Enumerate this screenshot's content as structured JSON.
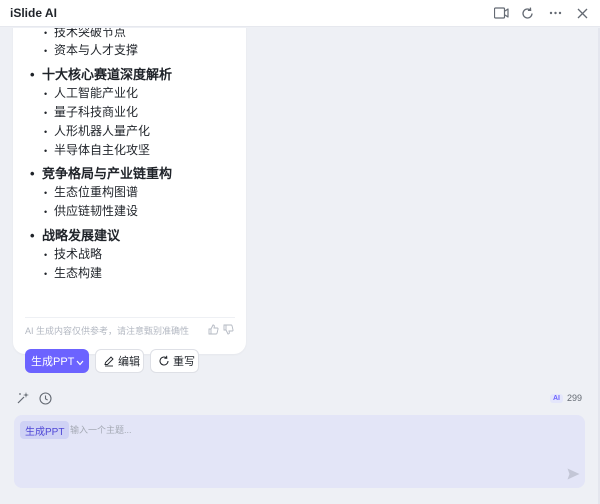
{
  "app": {
    "title": "iSlide AI"
  },
  "outline": {
    "top_items": [
      "技术突破节点",
      "资本与人才支撑"
    ],
    "sections": [
      {
        "title": "十大核心赛道深度解析",
        "items": [
          "人工智能产业化",
          "量子科技商业化",
          "人形机器人量产化",
          "半导体自主化攻坚"
        ]
      },
      {
        "title": "竞争格局与产业链重构",
        "items": [
          "生态位重构图谱",
          "供应链韧性建设"
        ]
      },
      {
        "title": "战略发展建议",
        "items": [
          "技术战略",
          "生态构建"
        ]
      }
    ]
  },
  "card": {
    "disclaimer": "AI 生成内容仅供参考，请注意甄别准确性",
    "generate_label": "生成PPT",
    "edit_label": "编辑",
    "rewrite_label": "重写"
  },
  "toolbar": {
    "credits_badge": "AI",
    "credits": "299"
  },
  "composer": {
    "tag": "生成PPT",
    "placeholder": "输入一个主题..."
  },
  "colors": {
    "accent": "#6c63ff",
    "bg": "#eef0f5",
    "input_bg": "#e3e5f7"
  },
  "icons": {
    "window": [
      "panel-icon",
      "refresh-icon",
      "more-icon",
      "close-icon"
    ],
    "card": [
      "thumb-up-icon",
      "thumb-down-icon",
      "chevron-down-icon",
      "edit-icon",
      "rewrite-icon"
    ],
    "toolbar": [
      "sparkle-icon",
      "history-icon"
    ],
    "composer": [
      "send-icon"
    ]
  }
}
